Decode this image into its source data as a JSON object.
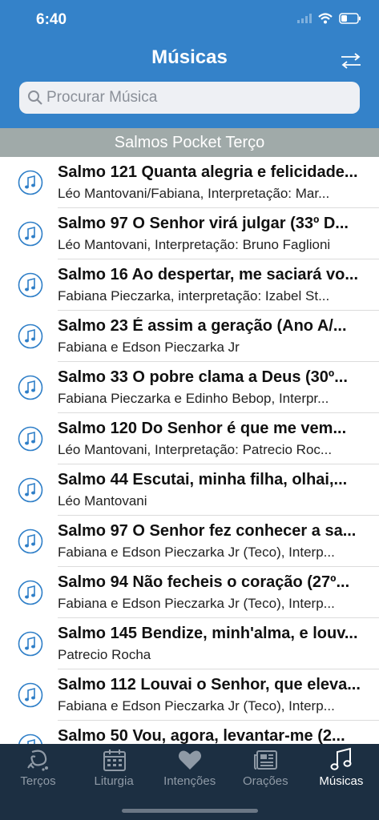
{
  "status": {
    "time": "6:40"
  },
  "header": {
    "title": "Músicas",
    "sort_icon": "sort-arrows-icon"
  },
  "search": {
    "placeholder": "Procurar Música"
  },
  "section": {
    "title": "Salmos Pocket Terço"
  },
  "songs": [
    {
      "title": "Salmo 121 Quanta alegria e felicidade...",
      "subtitle": "Léo Mantovani/Fabiana, Interpretação: Mar..."
    },
    {
      "title": "Salmo 97 O Senhor virá julgar (33º D...",
      "subtitle": "Léo Mantovani, Interpretação: Bruno Faglioni"
    },
    {
      "title": "Salmo 16 Ao despertar, me saciará vo...",
      "subtitle": "Fabiana Pieczarka, interpretação: Izabel St..."
    },
    {
      "title": "Salmo 23 É assim a geração (Ano A/...",
      "subtitle": "Fabiana e Edson Pieczarka Jr"
    },
    {
      "title": "Salmo 33 O pobre clama a Deus (30º...",
      "subtitle": "Fabiana Pieczarka e Edinho Bebop, Interpr..."
    },
    {
      "title": "Salmo 120 Do Senhor é que me vem...",
      "subtitle": "Léo Mantovani, Interpretação: Patrecio Roc..."
    },
    {
      "title": "Salmo 44 Escutai, minha filha, olhai,...",
      "subtitle": "Léo Mantovani"
    },
    {
      "title": "Salmo 97 O Senhor fez conhecer a sa...",
      "subtitle": "Fabiana e Edson Pieczarka Jr (Teco), Interp..."
    },
    {
      "title": "Salmo 94 Não fecheis o coração (27º...",
      "subtitle": "Fabiana e Edson Pieczarka Jr (Teco), Interp..."
    },
    {
      "title": "Salmo 145 Bendize, minh'alma, e louv...",
      "subtitle": "Patrecio Rocha"
    },
    {
      "title": "Salmo 112 Louvai o Senhor, que eleva...",
      "subtitle": "Fabiana e Edson Pieczarka Jr (Teco), Interp..."
    },
    {
      "title": "Salmo 50 Vou, agora, levantar-me (2...",
      "subtitle": ""
    }
  ],
  "tabs": [
    {
      "label": "Terços",
      "icon": "rosary-icon",
      "active": false
    },
    {
      "label": "Liturgia",
      "icon": "calendar-icon",
      "active": false
    },
    {
      "label": "Intenções",
      "icon": "heart-icon",
      "active": false
    },
    {
      "label": "Orações",
      "icon": "newspaper-icon",
      "active": false
    },
    {
      "label": "Músicas",
      "icon": "music-note-icon",
      "active": true
    }
  ],
  "colors": {
    "header": "#3482c9",
    "section": "#a0aaa9",
    "tabbar": "#1c2f42",
    "accent": "#2f7fc8"
  }
}
